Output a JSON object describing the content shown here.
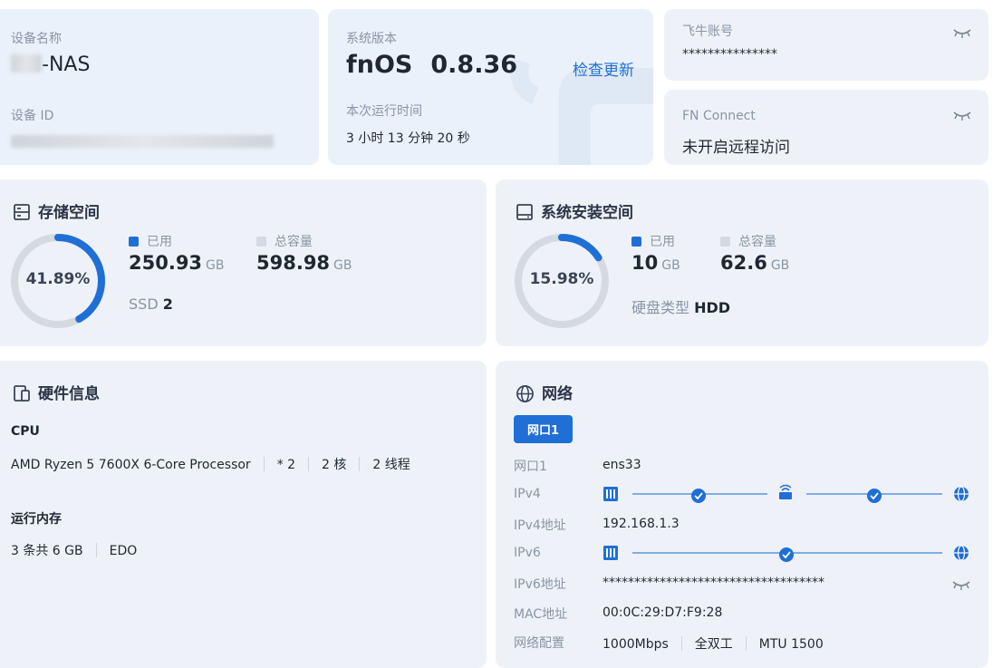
{
  "device": {
    "name_label": "设备名称",
    "name_suffix": "-NAS",
    "id_label": "设备 ID"
  },
  "system": {
    "version_label": "系统版本",
    "os_name": "fnOS",
    "version": "0.8.36",
    "check_update": "检查更新",
    "uptime_label": "本次运行时间",
    "uptime": "3 小时 13 分钟 20 秒"
  },
  "account": {
    "label": "飞牛账号",
    "value": "***************"
  },
  "fn_connect": {
    "label": "FN Connect",
    "value": "未开启远程访问"
  },
  "storage": {
    "title": "存储空间",
    "percent_text": "41.89%",
    "percent": 41.89,
    "used_label": "已用",
    "used_value": "250.93",
    "used_unit": "GB",
    "total_label": "总容量",
    "total_value": "598.98",
    "total_unit": "GB",
    "ssd_label": "SSD",
    "ssd_count": "2"
  },
  "sys_disk": {
    "title": "系统安装空间",
    "percent_text": "15.98%",
    "percent": 15.98,
    "used_label": "已用",
    "used_value": "10",
    "used_unit": "GB",
    "total_label": "总容量",
    "total_value": "62.6",
    "total_unit": "GB",
    "type_label": "硬盘类型",
    "type_value": "HDD"
  },
  "hardware": {
    "title": "硬件信息",
    "cpu_label": "CPU",
    "cpu_model": "AMD Ryzen 5 7600X 6-Core Processor",
    "cpu_count": "* 2",
    "cores": "2 核",
    "threads": "2 线程",
    "memory_label": "运行内存",
    "memory_value": "3 条共 6 GB",
    "memory_type": "EDO"
  },
  "network": {
    "title": "网络",
    "tab": "网口1",
    "rows": {
      "port_label": "网口1",
      "port_value": "ens33",
      "ipv4_label": "IPv4",
      "ipv4_addr_label": "IPv4地址",
      "ipv4_addr": "192.168.1.3",
      "ipv6_label": "IPv6",
      "ipv6_addr_label": "IPv6地址",
      "ipv6_addr": "***********************************",
      "mac_label": "MAC地址",
      "mac_value": "00:0C:29:D7:F9:28",
      "config_label": "网络配置",
      "speed": "1000Mbps",
      "duplex": "全双工",
      "mtu": "MTU 1500"
    }
  },
  "colors": {
    "accent": "#1f6fd6",
    "card_bg": "#eef2f8",
    "ring_bg": "#d5d9e0"
  },
  "icons": [
    "eye-closed-icon",
    "storage-icon",
    "disk-icon",
    "hardware-icon",
    "globe-icon",
    "ethernet-icon",
    "router-icon",
    "check-circle-icon"
  ]
}
